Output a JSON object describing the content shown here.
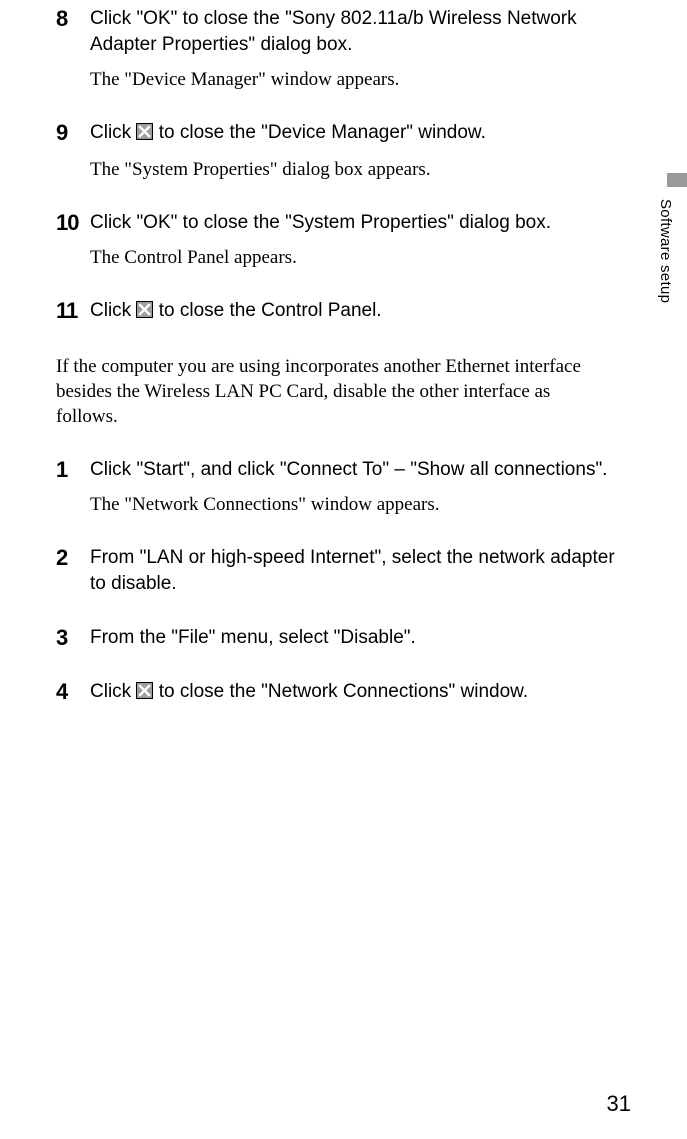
{
  "side_label": "Software setup",
  "page_number": "31",
  "stepsA": [
    {
      "num": "8",
      "text_before": "Click \"OK\" to close the \"Sony 802.11a/b Wireless Network Adapter Properties\" dialog box.",
      "text_after": "",
      "has_icon": false,
      "result": "The \"Device Manager\" window appears."
    },
    {
      "num": "9",
      "text_before": "Click ",
      "text_after": " to close the \"Device Manager\" window.",
      "has_icon": true,
      "result": "The \"System Properties\" dialog box appears."
    },
    {
      "num": "10",
      "text_before": "Click \"OK\" to close the \"System Properties\" dialog box.",
      "text_after": "",
      "has_icon": false,
      "result": "The Control Panel appears."
    },
    {
      "num": "11",
      "text_before": "Click ",
      "text_after": " to close the Control Panel.",
      "has_icon": true,
      "result": ""
    }
  ],
  "intro": "If the computer you are using incorporates another Ethernet interface besides the Wireless LAN PC Card, disable the other interface as follows.",
  "stepsB": [
    {
      "num": "1",
      "text_before": "Click \"Start\", and click \"Connect To\" – \"Show all connections\".",
      "text_after": "",
      "has_icon": false,
      "result": "The \"Network Connections\" window appears."
    },
    {
      "num": "2",
      "text_before": "From \"LAN or high-speed Internet\", select the network adapter to disable.",
      "text_after": "",
      "has_icon": false,
      "result": ""
    },
    {
      "num": "3",
      "text_before": "From the \"File\" menu, select \"Disable\".",
      "text_after": "",
      "has_icon": false,
      "result": ""
    },
    {
      "num": "4",
      "text_before": "Click ",
      "text_after": " to close the \"Network Connections\" window.",
      "has_icon": true,
      "result": ""
    }
  ]
}
